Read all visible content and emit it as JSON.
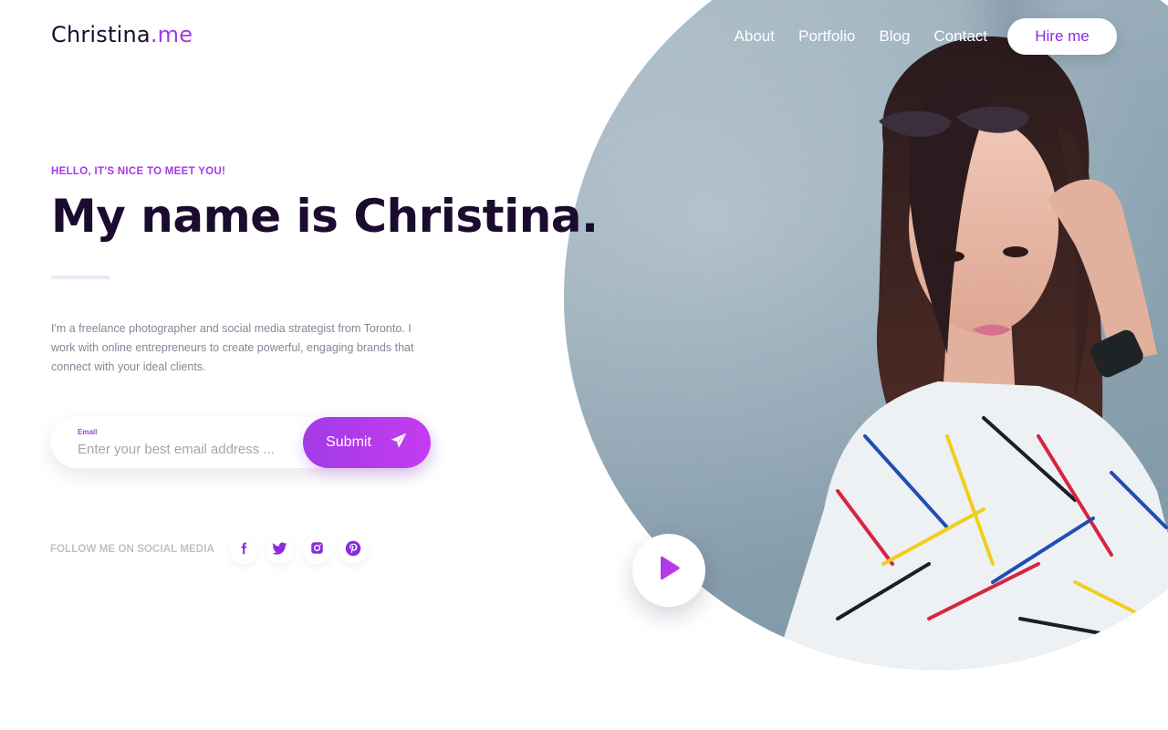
{
  "brand": {
    "name": "Christina",
    "suffix": ".me",
    "accent_color": "#a23be6",
    "text_color": "#1b0b2e"
  },
  "nav": {
    "links": [
      "About",
      "Portfolio",
      "Blog",
      "Contact"
    ],
    "cta_label": "Hire me"
  },
  "hero": {
    "eyebrow": "HELLO, IT'S NICE TO MEET YOU!",
    "headline": "My name is Christina.",
    "bio": "I'm a freelance photographer and social media strategist from Toronto. I work with online entrepreneurs to create powerful, engaging brands that connect with your ideal clients."
  },
  "subscribe": {
    "label": "Email",
    "placeholder": "Enter your best email address ...",
    "submit_label": "Submit",
    "submit_icon": "paper-plane-icon"
  },
  "social": {
    "title": "FOLLOW ME ON SOCIAL MEDIA",
    "icons": [
      "facebook-icon",
      "twitter-icon",
      "instagram-icon",
      "pinterest-icon"
    ]
  },
  "media": {
    "play_icon": "play-icon",
    "portrait": "portrait-photo"
  }
}
